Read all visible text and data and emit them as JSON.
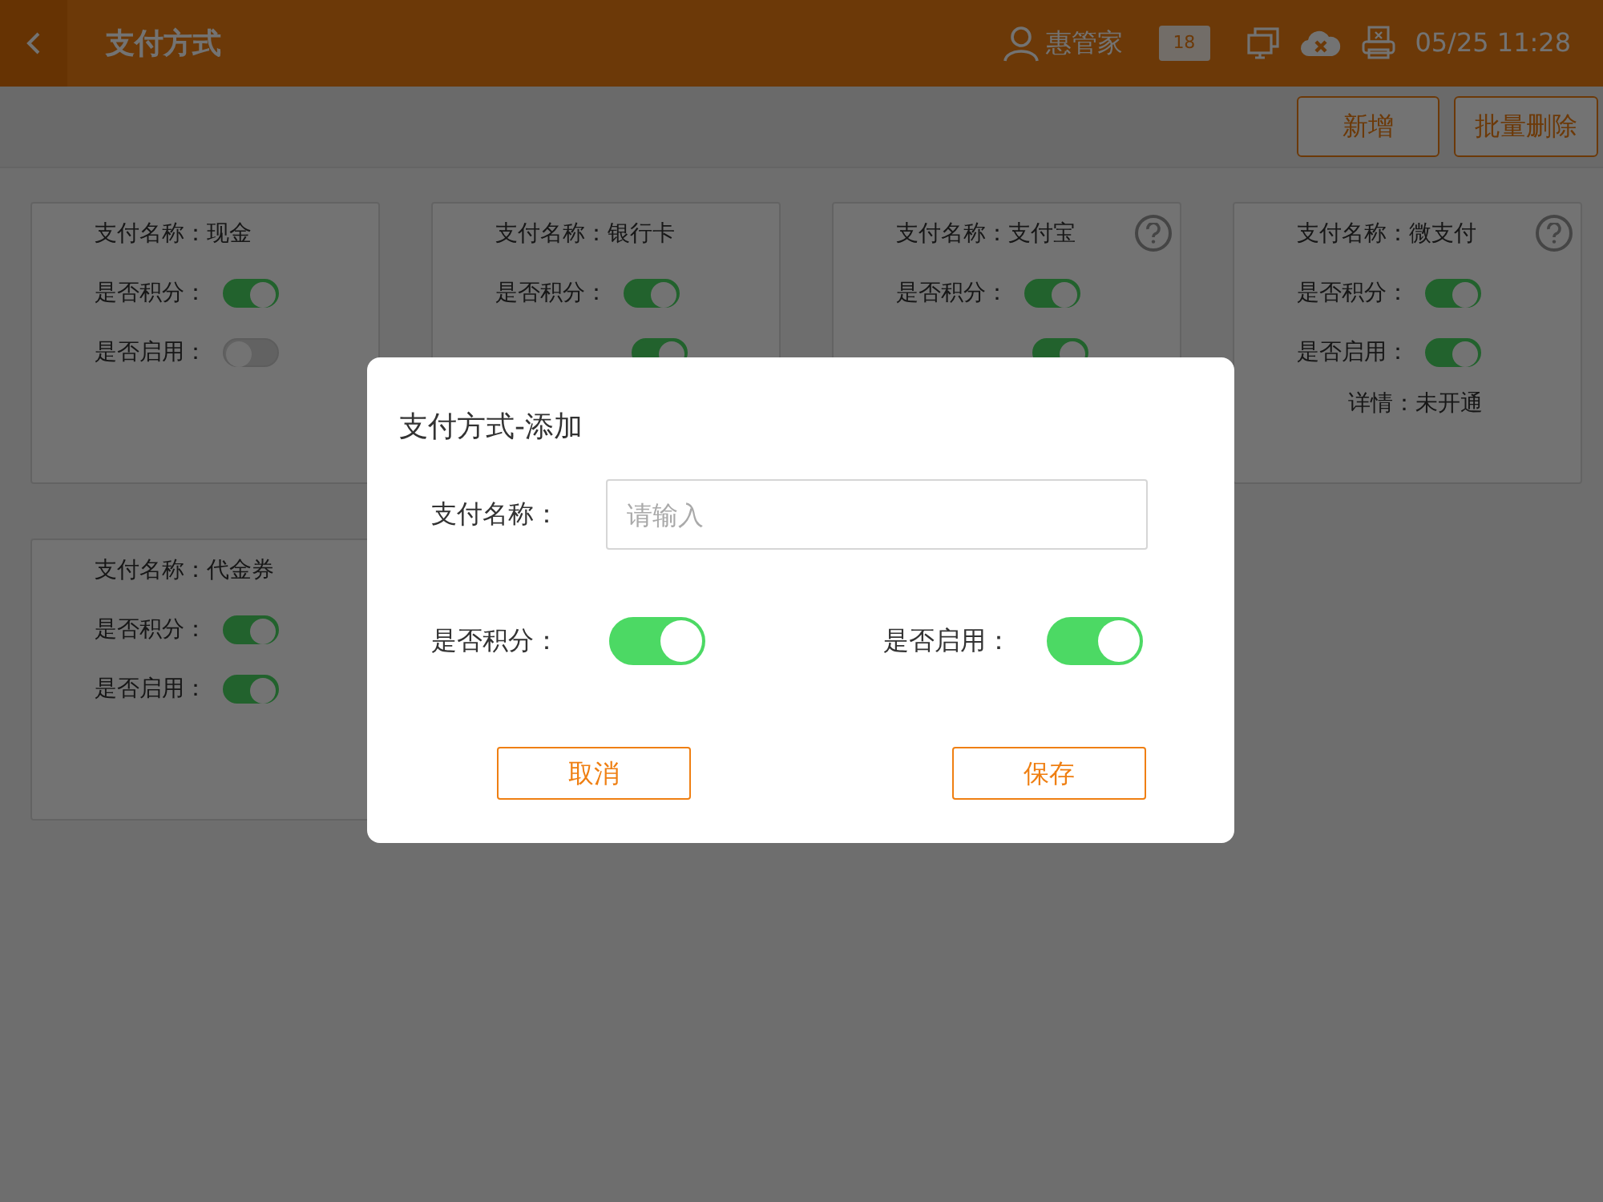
{
  "header": {
    "title": "支付方式",
    "user": "惠管家",
    "message_count": "18",
    "time": "05/25 11:28"
  },
  "toolbar": {
    "buttons": [
      "新增",
      "批量删除"
    ]
  },
  "cards": [
    {
      "name": "支付名称：现金",
      "help": false,
      "points_label": "是否积分：",
      "points_on": true,
      "enabled_label": "是否启用：",
      "enabled_on": false
    },
    {
      "name": "支付名称：银行卡",
      "help": false,
      "points_label": "是否积分：",
      "points_on": true,
      "enabled_on": true
    },
    {
      "name": "支付名称：支付宝",
      "help": true,
      "points_label": "是否积分：",
      "points_on": true,
      "enabled_on": true
    },
    {
      "name": "支付名称：微支付",
      "help": true,
      "points_label": "是否积分：",
      "points_on": true,
      "enabled_label": "是否启用：",
      "enabled_on": true,
      "detail": "详情：未开通"
    },
    {
      "name": "支付名称：代金券",
      "help": false,
      "points_label": "是否积分：",
      "points_on": true,
      "enabled_label": "是否启用：",
      "enabled_on": true
    }
  ],
  "dialog": {
    "title": "支付方式-添加",
    "name_label": "支付名称：",
    "name_placeholder": "请输入",
    "points_label": "是否积分：",
    "points_on": true,
    "enabled_label": "是否启用：",
    "enabled_on": true,
    "cancel": "取消",
    "save": "保存"
  }
}
